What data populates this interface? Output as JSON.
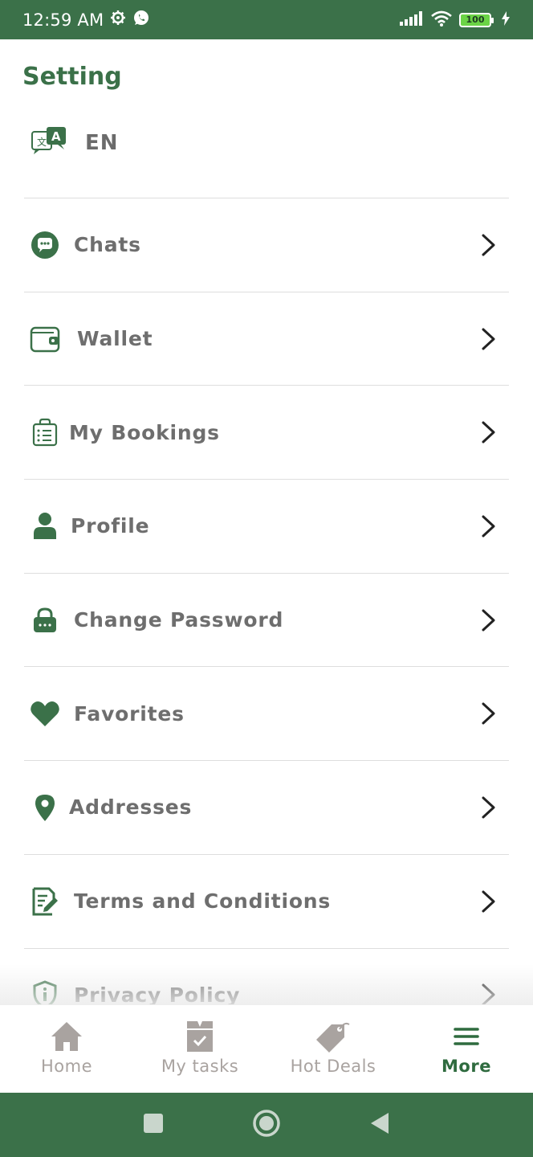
{
  "status_bar": {
    "time": "12:59 AM",
    "battery": "100",
    "icons": [
      "settings-gear-icon",
      "whatsapp-icon",
      "signal-icon",
      "wifi-icon",
      "battery-icon",
      "charging-icon"
    ]
  },
  "header": {
    "title": "Setting"
  },
  "language": {
    "label": "EN",
    "icon": "translate-icon"
  },
  "menu": {
    "items": [
      {
        "label": "Chats",
        "icon": "chat-icon"
      },
      {
        "label": "Wallet",
        "icon": "wallet-icon"
      },
      {
        "label": "My Bookings",
        "icon": "bookings-bag-icon"
      },
      {
        "label": "Profile",
        "icon": "person-icon"
      },
      {
        "label": "Change Password",
        "icon": "lock-icon"
      },
      {
        "label": "Favorites",
        "icon": "heart-icon"
      },
      {
        "label": "Addresses",
        "icon": "location-pin-icon"
      },
      {
        "label": "Terms and Conditions",
        "icon": "document-edit-icon"
      },
      {
        "label": "Privacy Policy",
        "icon": "shield-info-icon"
      }
    ]
  },
  "bottom_nav": {
    "items": [
      {
        "label": "Home",
        "icon": "home-icon",
        "active": false
      },
      {
        "label": "My tasks",
        "icon": "task-box-icon",
        "active": false
      },
      {
        "label": "Hot Deals",
        "icon": "tag-icon",
        "active": false
      },
      {
        "label": "More",
        "icon": "menu-icon",
        "active": true
      }
    ]
  },
  "colors": {
    "brand_green": "#3b7149",
    "text_gray": "#6e6e6e",
    "inactive_nav": "#a9a3a0",
    "divider": "#dedede"
  }
}
